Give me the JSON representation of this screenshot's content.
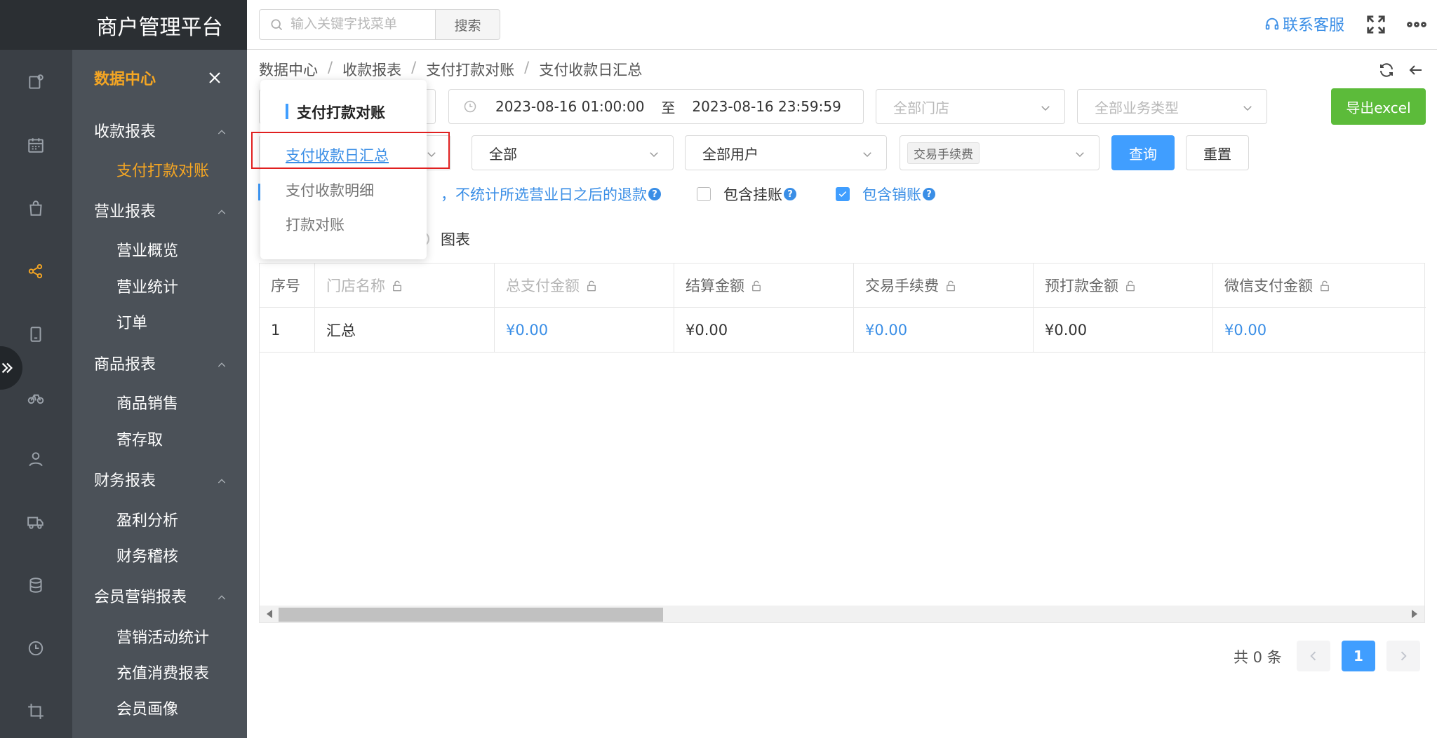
{
  "brand": "商户管理平台",
  "menu": {
    "header": "数据中心",
    "groups": [
      {
        "label": "收款报表",
        "items": [
          "支付打款对账"
        ]
      },
      {
        "label": "营业报表",
        "items": [
          "营业概览",
          "营业统计",
          "订单"
        ]
      },
      {
        "label": "商品报表",
        "items": [
          "商品销售",
          "寄存取"
        ]
      },
      {
        "label": "财务报表",
        "items": [
          "盈利分析",
          "财务稽核"
        ]
      },
      {
        "label": "会员营销报表",
        "items": [
          "营销活动统计",
          "充值消费报表",
          "会员画像"
        ]
      }
    ]
  },
  "header": {
    "search_placeholder": "输入关键字找菜单",
    "search_button": "搜索",
    "support": "联系客服"
  },
  "breadcrumb": [
    "数据中心",
    "收款报表",
    "支付打款对账",
    "支付收款日汇总"
  ],
  "filters": {
    "date_start": "2023-08-16 01:00:00",
    "date_to": "至",
    "date_end": "2023-08-16 23:59:59",
    "store": "全部门店",
    "biz_type": "全部业务类型",
    "export": "导出excel",
    "all": "全部",
    "all_users": "全部用户",
    "fee_tag": "交易手续费",
    "query": "查询",
    "reset": "重置",
    "note": "，不统计所选营业日之后的退款",
    "include_pending": "包含挂账",
    "include_writeoff": "包含销账",
    "chart_view": "图表"
  },
  "table": {
    "headers": [
      "序号",
      "门店名称",
      "总支付金额",
      "结算金额",
      "交易手续费",
      "预打款金额",
      "微信支付金额"
    ],
    "rows": [
      [
        "1",
        "汇总",
        "¥0.00",
        "¥0.00",
        "¥0.00",
        "¥0.00",
        "¥0.00"
      ]
    ]
  },
  "pagination": {
    "total": "共 0 条",
    "current": "1"
  },
  "popup": {
    "title": "支付打款对账",
    "items": [
      "支付收款日汇总",
      "支付收款明细",
      "打款对账"
    ]
  },
  "colors": {
    "accent": "#409eff",
    "menu_active": "#f5a623",
    "export": "#5cbb3a",
    "highlight": "#e02020"
  }
}
